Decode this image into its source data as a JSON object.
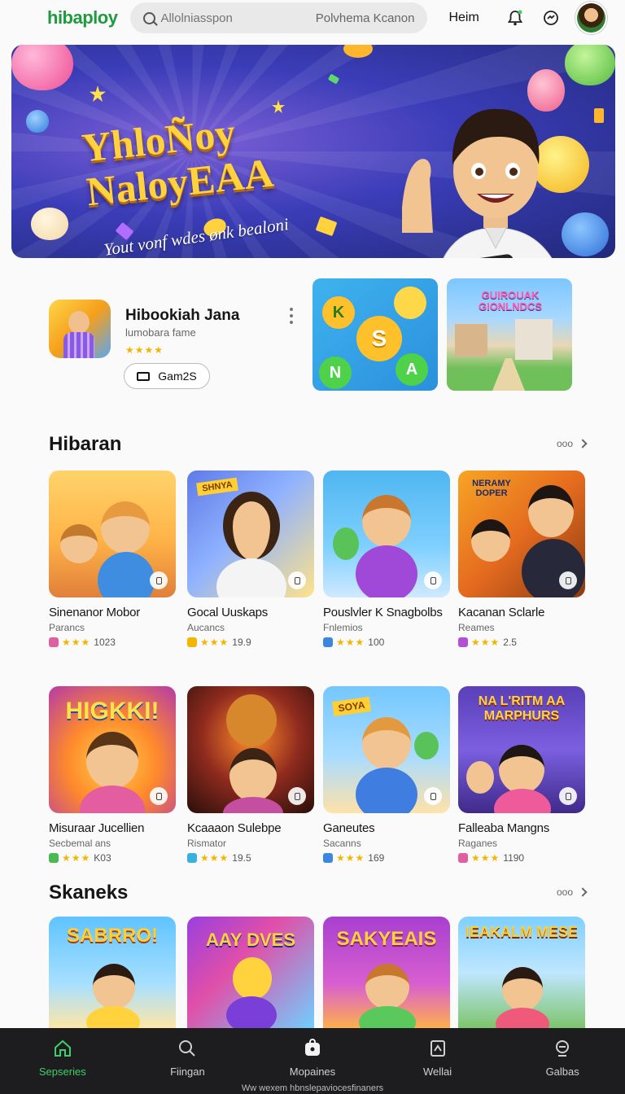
{
  "header": {
    "logo": "hibaploy",
    "search_placeholder": "Allolniasspon",
    "search_hint": "Polvhema Kcanon",
    "home_label": "Heim",
    "icons": [
      "bell-icon",
      "gamepad-icon",
      "avatar"
    ]
  },
  "hero": {
    "title_line1": "YhloÑoy",
    "title_line2": "NaloyEAA",
    "subtitle": "Yout vonf wdes ønk bealoni"
  },
  "featured": {
    "title": "Hibookiah Jana",
    "subtitle": "lumobara fame",
    "stars": "★★★★",
    "button_label": "Gam2S",
    "promo1_letters": [
      "K",
      "S",
      "N",
      "A"
    ],
    "promo2_label": "GUIROUAK GIONLNDCS"
  },
  "sections": [
    {
      "title": "Hibaran",
      "more": "ooo",
      "cards": [
        {
          "title": "Sinenanor Mobor",
          "sub": "Parancs",
          "stars": "★★★",
          "rating": "1023"
        },
        {
          "title": "Gocal Uuskaps",
          "sub": "Aucancs",
          "stars": "★★★",
          "rating": "19.9"
        },
        {
          "title": "Pouslvler K Snagbolbs",
          "sub": "Fnlemios",
          "stars": "★★★",
          "rating": "100"
        },
        {
          "title": "Kacanan Sclarle",
          "sub": "Reames",
          "stars": "★★★",
          "rating": "2.5"
        }
      ]
    },
    {
      "title": "",
      "cards": [
        {
          "title": "Misuraar Jucellien",
          "sub": "Secbemal ans",
          "stars": "★★★",
          "rating": "K03",
          "badge": "HIGKKI!"
        },
        {
          "title": "Kcaaaon Sulebpe",
          "sub": "Rismator",
          "stars": "★★★",
          "rating": "19.5"
        },
        {
          "title": "Ganeutes",
          "sub": "Sacanns",
          "stars": "★★★",
          "rating": "169",
          "badge": "SOYA"
        },
        {
          "title": "Falleaba Mangns",
          "sub": "Raganes",
          "stars": "★★★",
          "rating": "1190",
          "badge": "NA L'RITM AA MARPHURS"
        }
      ]
    },
    {
      "title": "Skaneks",
      "more": "ooo",
      "cards": [
        {
          "badge": "SABRRO!"
        },
        {
          "badge": "AAY DVES"
        },
        {
          "badge": "SAKYEAIS"
        },
        {
          "badge": "IEAKALM MESE"
        }
      ]
    }
  ],
  "featured_card_badges": {
    "card1_2": "SHNYA",
    "card1_4": "NERAMY DOPER"
  },
  "bottom_nav": [
    {
      "label": "Sepseries",
      "icon": "home-icon",
      "active": true
    },
    {
      "label": "Fiingan",
      "icon": "search-icon",
      "active": false
    },
    {
      "label": "Mopaines",
      "icon": "bag-icon",
      "active": false
    },
    {
      "label": "Wellai",
      "icon": "library-icon",
      "active": false
    },
    {
      "label": "Galbas",
      "icon": "profile-icon",
      "active": false
    }
  ],
  "footer_url": "Ww wexem hbnslepaviocesfinaners",
  "colors": {
    "brand": "#1f9a3f",
    "accent": "#3ecf6b",
    "star": "#f2b500",
    "nav_bg": "#1d1d1f"
  }
}
